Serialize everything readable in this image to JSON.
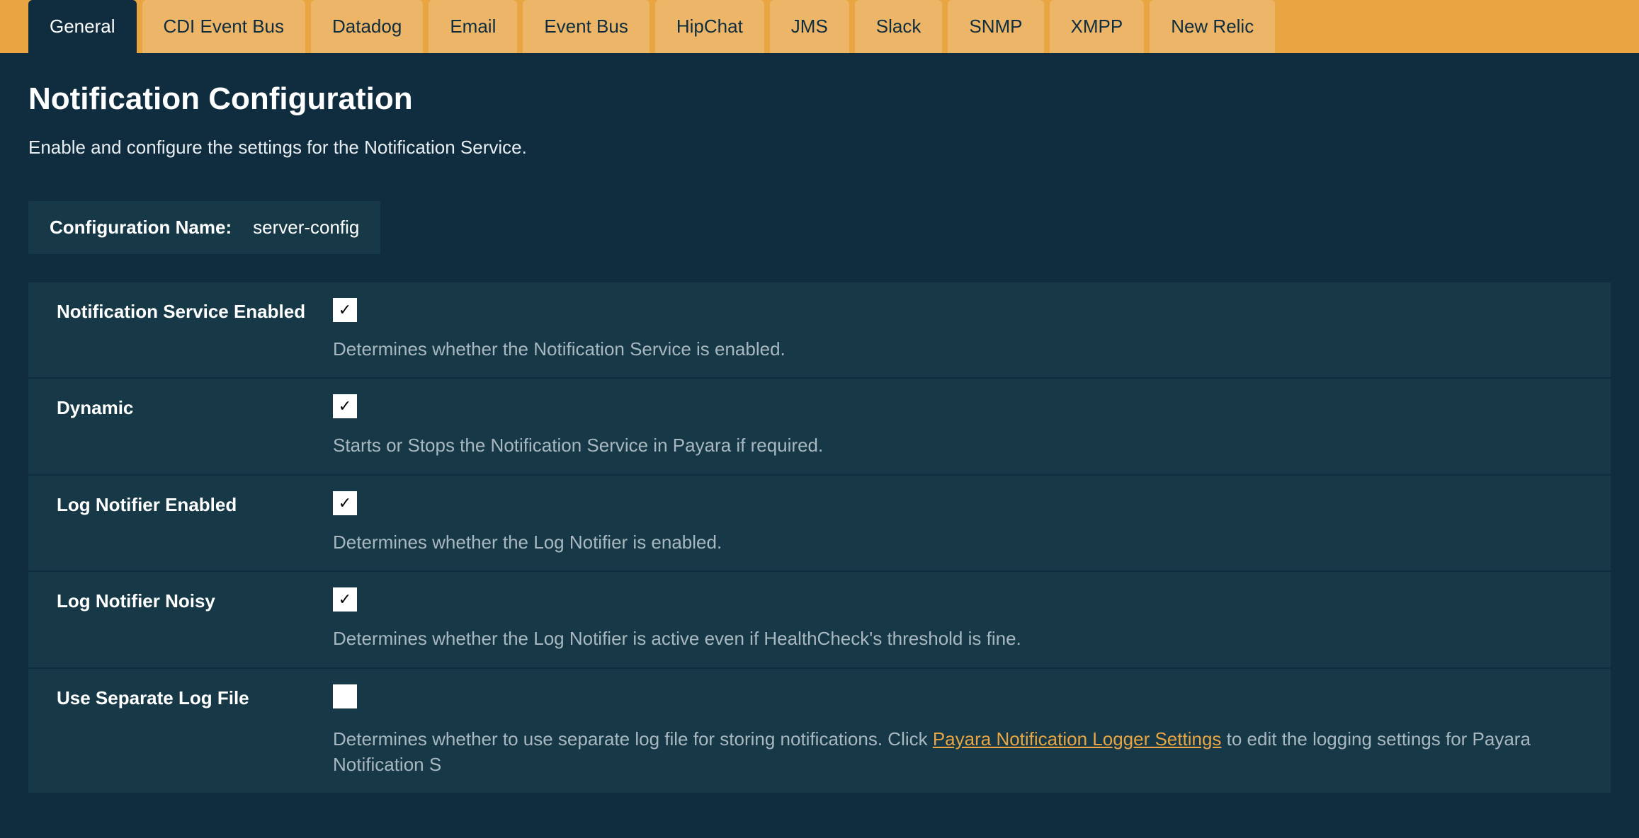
{
  "tabs": [
    {
      "label": "General",
      "active": true
    },
    {
      "label": "CDI Event Bus",
      "active": false
    },
    {
      "label": "Datadog",
      "active": false
    },
    {
      "label": "Email",
      "active": false
    },
    {
      "label": "Event Bus",
      "active": false
    },
    {
      "label": "HipChat",
      "active": false
    },
    {
      "label": "JMS",
      "active": false
    },
    {
      "label": "Slack",
      "active": false
    },
    {
      "label": "SNMP",
      "active": false
    },
    {
      "label": "XMPP",
      "active": false
    },
    {
      "label": "New Relic",
      "active": false
    }
  ],
  "page": {
    "title": "Notification Configuration",
    "subtitle": "Enable and configure the settings for the Notification Service."
  },
  "config": {
    "name_label": "Configuration Name:",
    "name_value": "server-config"
  },
  "settings": [
    {
      "label": "Notification Service Enabled",
      "checked": true,
      "description": "Determines whether the Notification Service is enabled."
    },
    {
      "label": "Dynamic",
      "checked": true,
      "description": "Starts or Stops the Notification Service in Payara if required."
    },
    {
      "label": "Log Notifier Enabled",
      "checked": true,
      "description": "Determines whether the Log Notifier is enabled."
    },
    {
      "label": "Log Notifier Noisy",
      "checked": true,
      "description": "Determines whether the Log Notifier is active even if HealthCheck's threshold is fine."
    },
    {
      "label": "Use Separate Log File",
      "checked": false,
      "description_prefix": "Determines whether to use separate log file for storing notifications. Click ",
      "link_text": "Payara Notification Logger Settings",
      "description_suffix": " to edit the logging settings for Payara Notification S"
    }
  ]
}
